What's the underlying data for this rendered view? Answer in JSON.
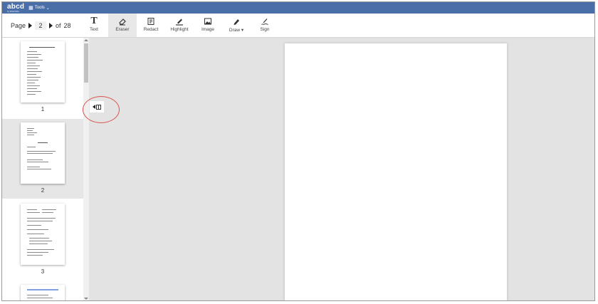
{
  "app": {
    "logo_text": "abcd",
    "logo_subtext": "by BIGFIRM",
    "tools_menu_label": "Tools"
  },
  "pager": {
    "page_label": "Page",
    "current_page": "2",
    "of_label": "of",
    "total_pages": "28"
  },
  "toolbar": {
    "tools": [
      {
        "label": "Text",
        "icon": "text-icon",
        "active": false
      },
      {
        "label": "Eraser",
        "icon": "eraser-icon",
        "active": true
      },
      {
        "label": "Redact",
        "icon": "redact-icon",
        "active": false
      },
      {
        "label": "Highlight",
        "icon": "highlight-icon",
        "active": false
      },
      {
        "label": "Image",
        "icon": "image-icon",
        "active": false
      },
      {
        "label": "Draw ▾",
        "icon": "draw-icon",
        "active": false
      },
      {
        "label": "Sign",
        "icon": "sign-icon",
        "active": false
      }
    ]
  },
  "sidebar": {
    "thumbnails": [
      {
        "number": "1",
        "selected": false
      },
      {
        "number": "2",
        "selected": true
      },
      {
        "number": "3",
        "selected": false
      }
    ]
  },
  "colors": {
    "appbar": "#4a6ea8",
    "highlight_circle": "#d9534f",
    "viewer_bg": "#e3e3e3"
  }
}
